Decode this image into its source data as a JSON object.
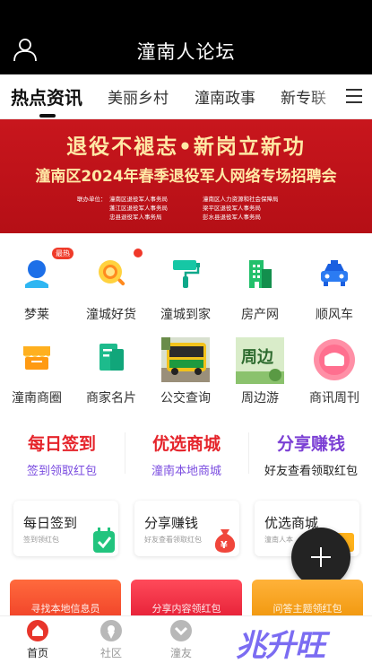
{
  "header": {
    "title": "潼南人论坛"
  },
  "tabs": [
    {
      "label": "热点资讯"
    },
    {
      "label": "美丽乡村"
    },
    {
      "label": "潼南政事"
    },
    {
      "label": "新专联"
    }
  ],
  "banner": {
    "title": "退役不褪志•新岗立新功",
    "subtitle": "潼南区2024年春季退役军人网络专场招聘会",
    "org_label": "联办单位：",
    "orgs": [
      [
        "潼南区退役军人事务局",
        "潼南区人力资源和社会保障局"
      ],
      [
        "蓬江区退役军人事务局",
        "梁平区退役军人事务局"
      ],
      [
        "忠县退役军人事务局",
        "彭水县退役军人事务局"
      ]
    ]
  },
  "icons": [
    {
      "label": "梦莱",
      "icon": "person-icon"
    },
    {
      "label": "潼城好货",
      "icon": "search-bag-icon"
    },
    {
      "label": "潼城到家",
      "icon": "paint-roller-icon"
    },
    {
      "label": "房产网",
      "icon": "building-icon"
    },
    {
      "label": "顺风车",
      "icon": "car-icon"
    },
    {
      "label": "潼南商圈",
      "icon": "store-icon"
    },
    {
      "label": "商家名片",
      "icon": "card-icon"
    },
    {
      "label": "公交查询",
      "icon": "bus-photo-icon"
    },
    {
      "label": "周边游",
      "icon": "travel-photo-icon"
    },
    {
      "label": "商讯周刊",
      "icon": "news-icon"
    }
  ],
  "badge_hot": "最热",
  "promos": [
    {
      "title": "每日签到",
      "sub": "签到领取红包",
      "title_color": "#e5242b",
      "sub_color": "#7b4de0"
    },
    {
      "title": "优选商城",
      "sub": "潼南本地商城",
      "title_color": "#e5242b",
      "sub_color": "#7b4de0"
    },
    {
      "title": "分享赚钱",
      "sub": "好友查看领取红包",
      "title_color": "#7b3fd4",
      "sub_color": "#222222"
    }
  ],
  "cards": [
    {
      "title": "每日签到",
      "sub": "签到领红包"
    },
    {
      "title": "分享赚钱",
      "sub": "好友查看领取红包"
    },
    {
      "title": "优选商城",
      "sub": "潼南人本"
    }
  ],
  "strips": [
    {
      "text": "寻找本地信息员"
    },
    {
      "text": "分享内容领红包"
    },
    {
      "text": "问答主题领红包"
    }
  ],
  "bottom_nav": [
    {
      "label": "首页"
    },
    {
      "label": "社区"
    },
    {
      "label": "潼友"
    }
  ],
  "watermark": "兆升旺"
}
